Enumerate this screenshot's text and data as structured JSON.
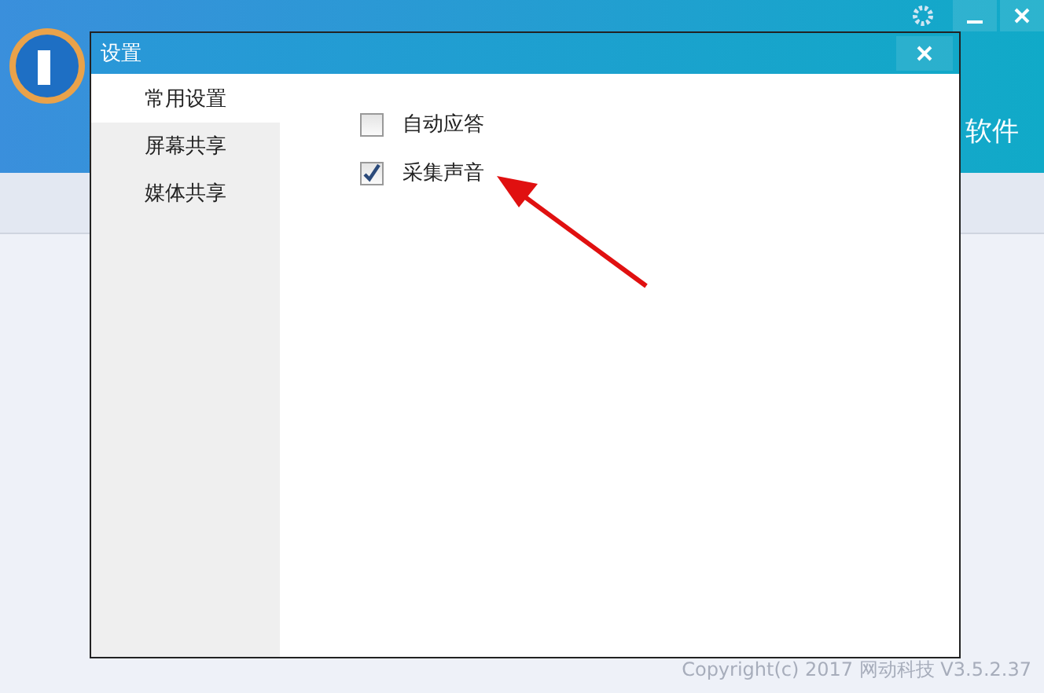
{
  "app": {
    "header_text": "软件",
    "copyright": "Copyright(c) 2017 网动科技 V3.5.2.37"
  },
  "dialog": {
    "title": "设置",
    "nav": [
      {
        "label": "常用设置",
        "selected": true
      },
      {
        "label": "屏幕共享",
        "selected": false
      },
      {
        "label": "媒体共享",
        "selected": false
      }
    ],
    "options": [
      {
        "label": "自动应答",
        "checked": false
      },
      {
        "label": "采集声音",
        "checked": true
      }
    ]
  }
}
